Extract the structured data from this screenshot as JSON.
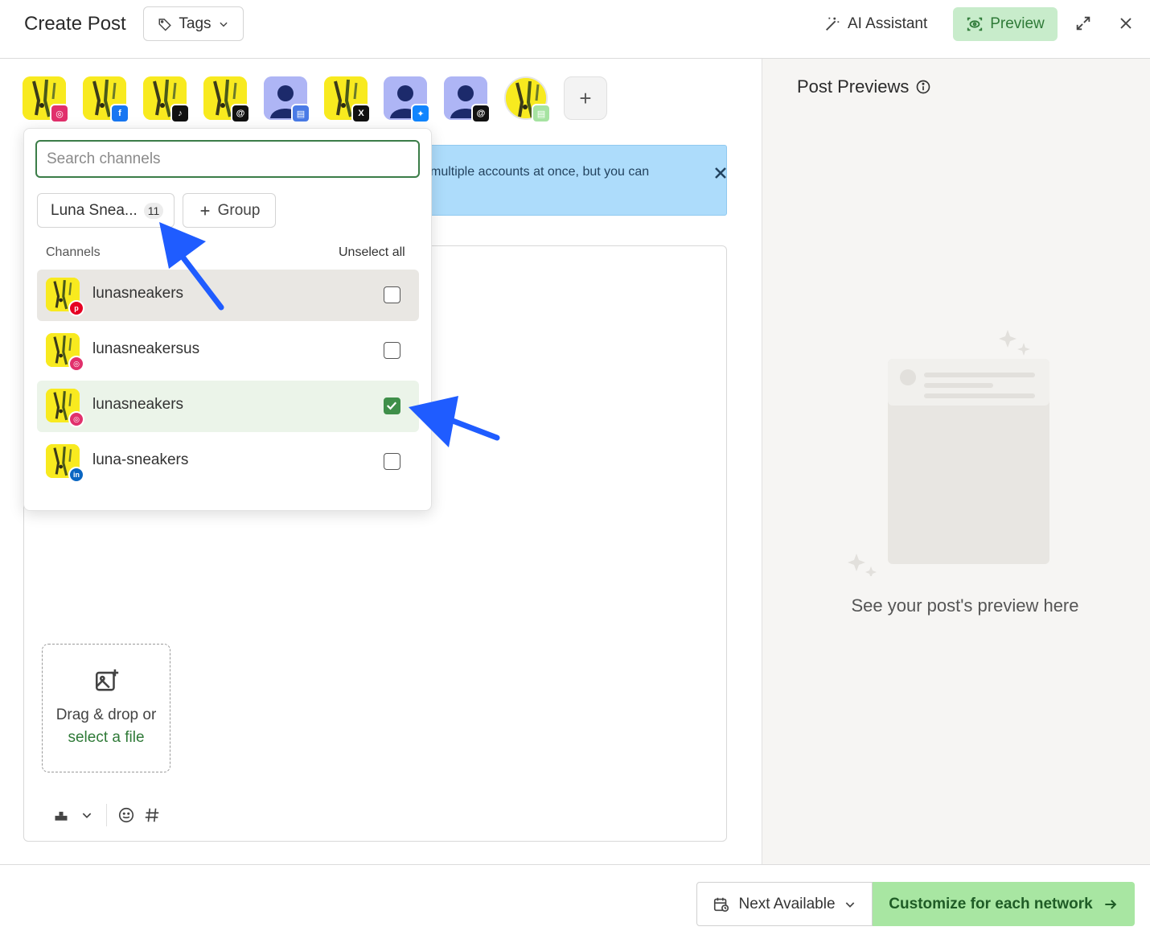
{
  "header": {
    "title": "Create Post",
    "tags_label": "Tags",
    "ai_label": "AI Assistant",
    "preview_label": "Preview"
  },
  "avatars": [
    {
      "kind": "sneaker",
      "network": "instagram",
      "color": "#e1306c",
      "glyph": "◎"
    },
    {
      "kind": "sneaker",
      "network": "facebook",
      "color": "#1877f2",
      "glyph": "f"
    },
    {
      "kind": "sneaker",
      "network": "tiktok",
      "color": "#111111",
      "glyph": "♪"
    },
    {
      "kind": "sneaker",
      "network": "threads",
      "color": "#111111",
      "glyph": "@"
    },
    {
      "kind": "person",
      "network": "google-business",
      "color": "#4a7be6",
      "glyph": "▤"
    },
    {
      "kind": "sneaker",
      "network": "x",
      "color": "#111111",
      "glyph": "X"
    },
    {
      "kind": "person",
      "network": "bluesky",
      "color": "#1185fe",
      "glyph": "✦"
    },
    {
      "kind": "person",
      "network": "threads",
      "color": "#111111",
      "glyph": "@"
    },
    {
      "kind": "sneaker",
      "network": "start-page",
      "color": "#a6e3a1",
      "glyph": "▤"
    }
  ],
  "banner": {
    "text": "multiple accounts at once, but you can"
  },
  "dropzone": {
    "text": "Drag & drop or",
    "link": "select a file"
  },
  "right_panel": {
    "title": "Post Previews",
    "placeholder": "See your post's preview here"
  },
  "footer": {
    "schedule_label": "Next Available",
    "customize_label": "Customize for each network"
  },
  "popup": {
    "search_placeholder": "Search channels",
    "group_name": "Luna Snea...",
    "group_count": "11",
    "add_group_label": "Group",
    "channels_label": "Channels",
    "unselect_label": "Unselect all",
    "channels": [
      {
        "name": "lunasneakers",
        "network": "pinterest",
        "color": "#e60023",
        "glyph": "p",
        "checked": false,
        "state": "hover"
      },
      {
        "name": "lunasneakersus",
        "network": "instagram",
        "color": "#e1306c",
        "glyph": "◎",
        "checked": false,
        "state": ""
      },
      {
        "name": "lunasneakers",
        "network": "instagram",
        "color": "#e1306c",
        "glyph": "◎",
        "checked": true,
        "state": "sel"
      },
      {
        "name": "luna-sneakers",
        "network": "linkedin",
        "color": "#0a66c2",
        "glyph": "in",
        "checked": false,
        "state": ""
      }
    ]
  },
  "colors": {
    "accent": "#3f8f4a",
    "preview_bg": "#c8eccb",
    "customize_bg": "#a8e6a2",
    "banner_bg": "#addcfb",
    "annotation_arrow": "#1f5cff"
  }
}
